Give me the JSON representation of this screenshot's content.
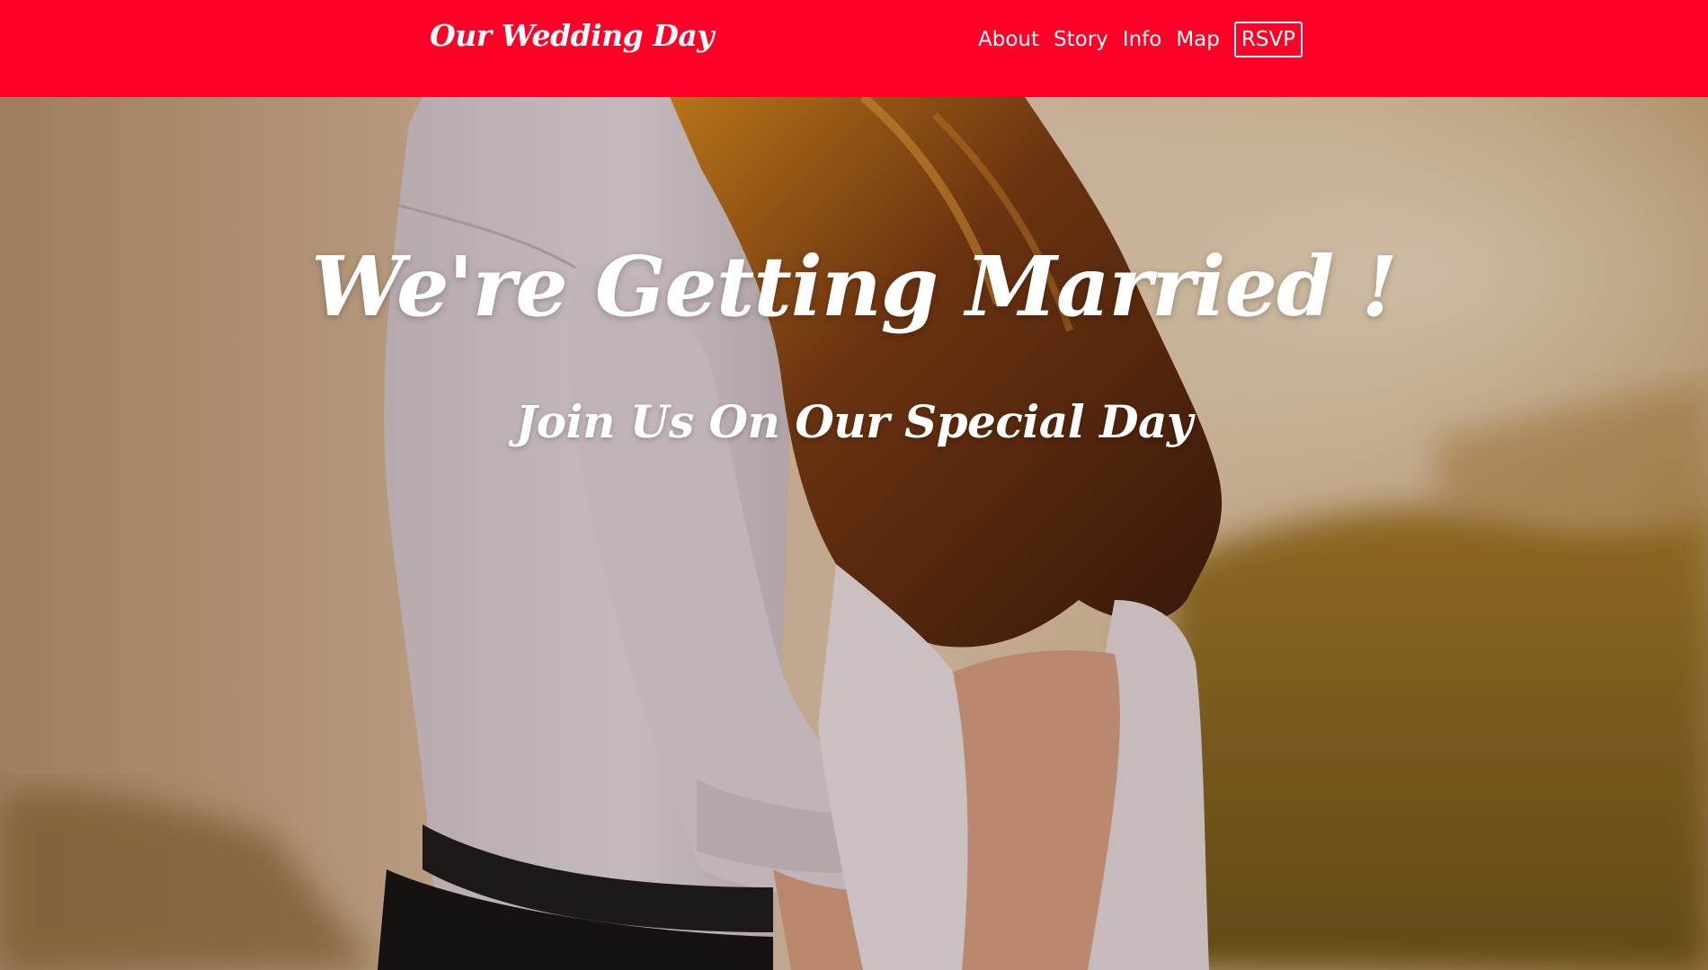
{
  "navbar": {
    "brand": "Our Wedding Day",
    "links": [
      "About",
      "Story",
      "Info",
      "Map"
    ],
    "rsvp_label": "RSVP",
    "background_color": "#ff0026"
  },
  "hero": {
    "title": "We're Getting Married !",
    "subtitle": "Join Us On Our Special Day",
    "image": "couple-embrace-photo"
  }
}
